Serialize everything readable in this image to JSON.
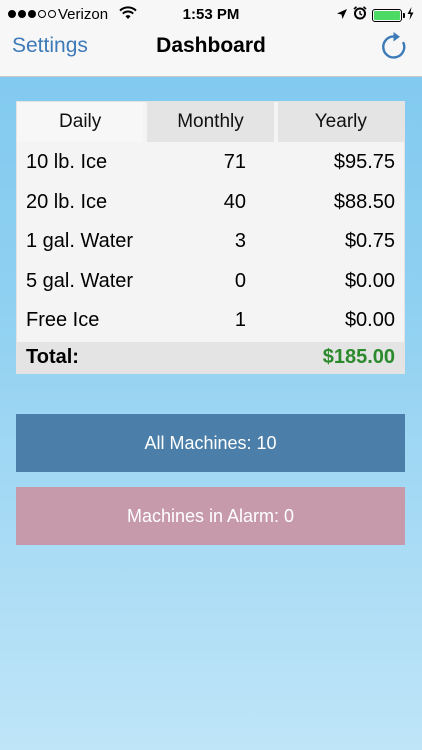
{
  "status_bar": {
    "carrier": "Verizon",
    "time": "1:53 PM",
    "signal_bars_filled": 3,
    "signal_bars_total": 5,
    "battery_level": 1.0,
    "battery_color": "#4cd964"
  },
  "nav": {
    "back_label": "Settings",
    "title": "Dashboard",
    "refresh_icon": "refresh-icon"
  },
  "tabs": {
    "daily": "Daily",
    "monthly": "Monthly",
    "yearly": "Yearly",
    "active": "daily"
  },
  "rows": [
    {
      "name": "10 lb. Ice",
      "qty": "71",
      "amount": "$95.75"
    },
    {
      "name": "20 lb. Ice",
      "qty": "40",
      "amount": "$88.50"
    },
    {
      "name": "1 gal. Water",
      "qty": "3",
      "amount": "$0.75"
    },
    {
      "name": "5 gal. Water",
      "qty": "0",
      "amount": "$0.00"
    },
    {
      "name": "Free Ice",
      "qty": "1",
      "amount": "$0.00"
    }
  ],
  "total": {
    "label": "Total:",
    "value": "$185.00",
    "color": "#2b8a2b"
  },
  "buttons": {
    "all_machines": "All Machines: 10",
    "machines_in_alarm": "Machines in Alarm: 0"
  },
  "colors": {
    "accent": "#3d7ab8",
    "all_machines_bg": "#4b7faa",
    "alarm_bg": "#c69aab",
    "background_top": "#7ec8ef",
    "background_bottom": "#bfe5f8"
  }
}
